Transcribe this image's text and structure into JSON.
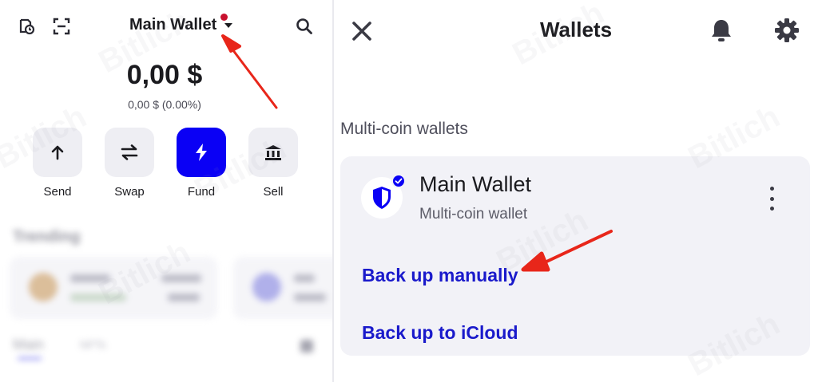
{
  "left_panel": {
    "wallet_title": "Main Wallet",
    "balance": "0,00 $",
    "balance_sub": "0,00 $ (0.00%)",
    "icons": {
      "history": "history-icon",
      "scan": "scan-icon",
      "search": "search-icon"
    },
    "actions": [
      {
        "label": "Send",
        "icon": "arrow-up-icon"
      },
      {
        "label": "Swap",
        "icon": "swap-icon"
      },
      {
        "label": "Fund",
        "icon": "lightning-icon"
      },
      {
        "label": "Sell",
        "icon": "bank-icon"
      }
    ],
    "blurred": {
      "section_title": "Trending",
      "tab_main": "Main",
      "tab_nfts": "NFTs"
    },
    "colors": {
      "accent": "#0a00f5",
      "notification_dot": "#c8102e"
    }
  },
  "right_panel": {
    "close_icon": "close-icon",
    "title": "Wallets",
    "bell_icon": "bell-icon",
    "settings_icon": "gear-icon",
    "section_label": "Multi-coin wallets",
    "wallet": {
      "name": "Main Wallet",
      "subtitle": "Multi-coin wallet",
      "icon": "shield-icon",
      "badge": "check-badge-icon",
      "menu_icon": "more-vertical-icon"
    },
    "links": {
      "backup_manual": "Back up manually",
      "backup_icloud": "Back up to iCloud"
    },
    "colors": {
      "link": "#1a1acb",
      "card_bg": "#f2f2f7"
    }
  },
  "annotations": {
    "arrow_color": "#e8261a"
  }
}
